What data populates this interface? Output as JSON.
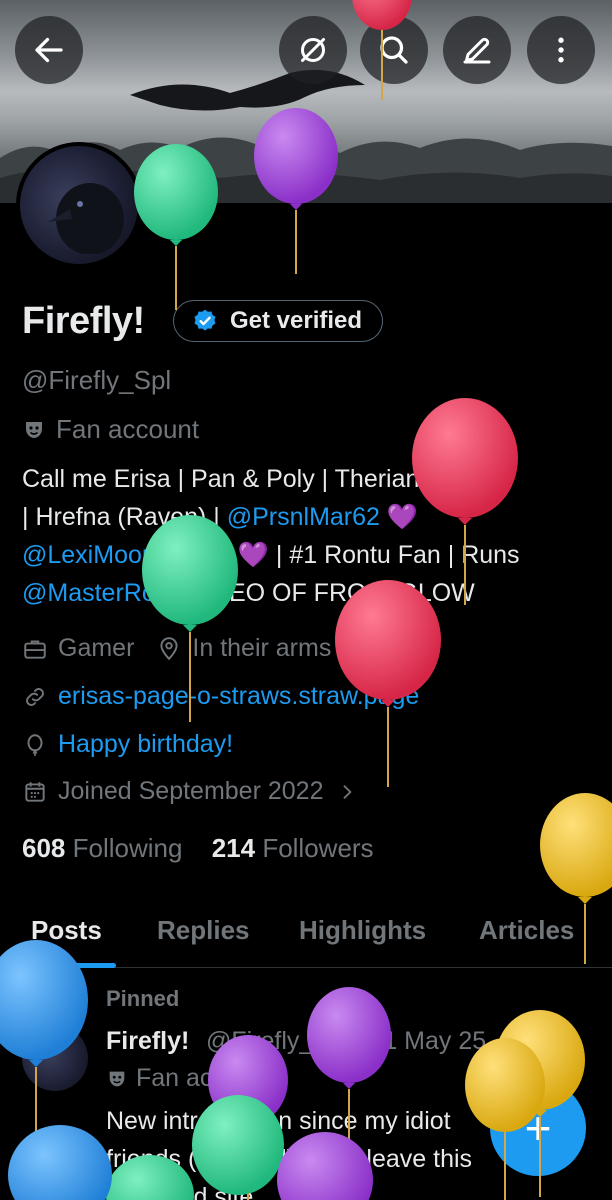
{
  "header": {
    "back_icon": "arrow-left-icon",
    "actions": [
      "hide-icon",
      "search-icon",
      "edit-icon",
      "more-vertical-icon"
    ]
  },
  "profile": {
    "name": "Firefly!",
    "verify_label": "Get verified",
    "handle": "@Firefly_Spl",
    "category": "Fan account",
    "bio": {
      "line1": "Call me Erisa | Pan & Poly | Therian",
      "line2_text": "| Hrefna (Raven) | ",
      "mention1": "@PrsnlMar62",
      "heart": "💜",
      "mention2": "@LexiMoonQueen",
      "line3_text": " | #1 Rontu Fan | Runs",
      "mention3": "@MasterRontu",
      "line4_text": " | CEO OF FROSTGLOW"
    },
    "profession": "Gamer",
    "location": "In their arms",
    "website": "erisas-page-o-straws.straw.page",
    "birthday": "Happy birthday!",
    "joined": "Joined September 2022",
    "following_count": "608",
    "following_label": "Following",
    "followers_count": "214",
    "followers_label": "Followers"
  },
  "tabs": [
    {
      "label": "Posts",
      "active": true
    },
    {
      "label": "Replies",
      "active": false
    },
    {
      "label": "Highlights",
      "active": false
    },
    {
      "label": "Articles",
      "active": false
    }
  ],
  "pinned_post": {
    "pinned_label": "Pinned",
    "name": "Firefly!",
    "handle": "@Firefly_...",
    "date": "· 11 May 25",
    "category": "Fan account",
    "text": "New introduction since my idiot friends (love yall) won't leave this accursed site."
  },
  "fab": {
    "label": "+"
  },
  "colors": {
    "accent": "#1d9bf0",
    "background": "#000000",
    "text_primary": "#e7e9ea",
    "text_secondary": "#71767b",
    "balloon_green": "#2ecc8f",
    "balloon_purple": "#9b3fd6",
    "balloon_red": "#e0334f",
    "balloon_yellow": "#e8b91a",
    "balloon_blue": "#2a8fe0"
  }
}
